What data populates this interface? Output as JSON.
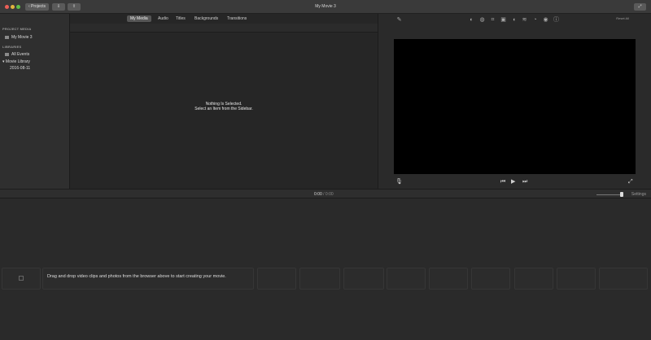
{
  "window": {
    "title": "My Movie 3",
    "projects_label": "Projects"
  },
  "tabs": [
    {
      "label": "My Media",
      "active": true
    },
    {
      "label": "Audio",
      "active": false
    },
    {
      "label": "Titles",
      "active": false
    },
    {
      "label": "Backgrounds",
      "active": false
    },
    {
      "label": "Transitions",
      "active": false
    }
  ],
  "sidebar": {
    "project_media_header": "PROJECT MEDIA",
    "project_item": "My Movie 3",
    "libraries_header": "LIBRARIES",
    "all_events": "All Events",
    "movie_library": "Movie Library",
    "event_date": "2016-08-11"
  },
  "browser": {
    "empty_line1": "Nothing Is Selected.",
    "empty_line2": "Select an Item from the Sidebar."
  },
  "viewer": {
    "reset_all": "Reset All"
  },
  "timeline": {
    "current_time": "0:00",
    "separator": "/",
    "total_time": "0:00",
    "settings_label": "Settings",
    "drop_message": "Drag and drop video clips and photos from the browser above to start creating your movie."
  },
  "icons": {
    "magic_wand": "✎",
    "adjust": [
      "◐",
      "◍",
      "⌗",
      "▣",
      "◖",
      "≋",
      "◔",
      "◉",
      "ⓘ"
    ]
  },
  "colors": {
    "accent_red": "#ec5f57",
    "accent_yellow": "#e1b53f",
    "accent_green": "#5fbf48"
  }
}
